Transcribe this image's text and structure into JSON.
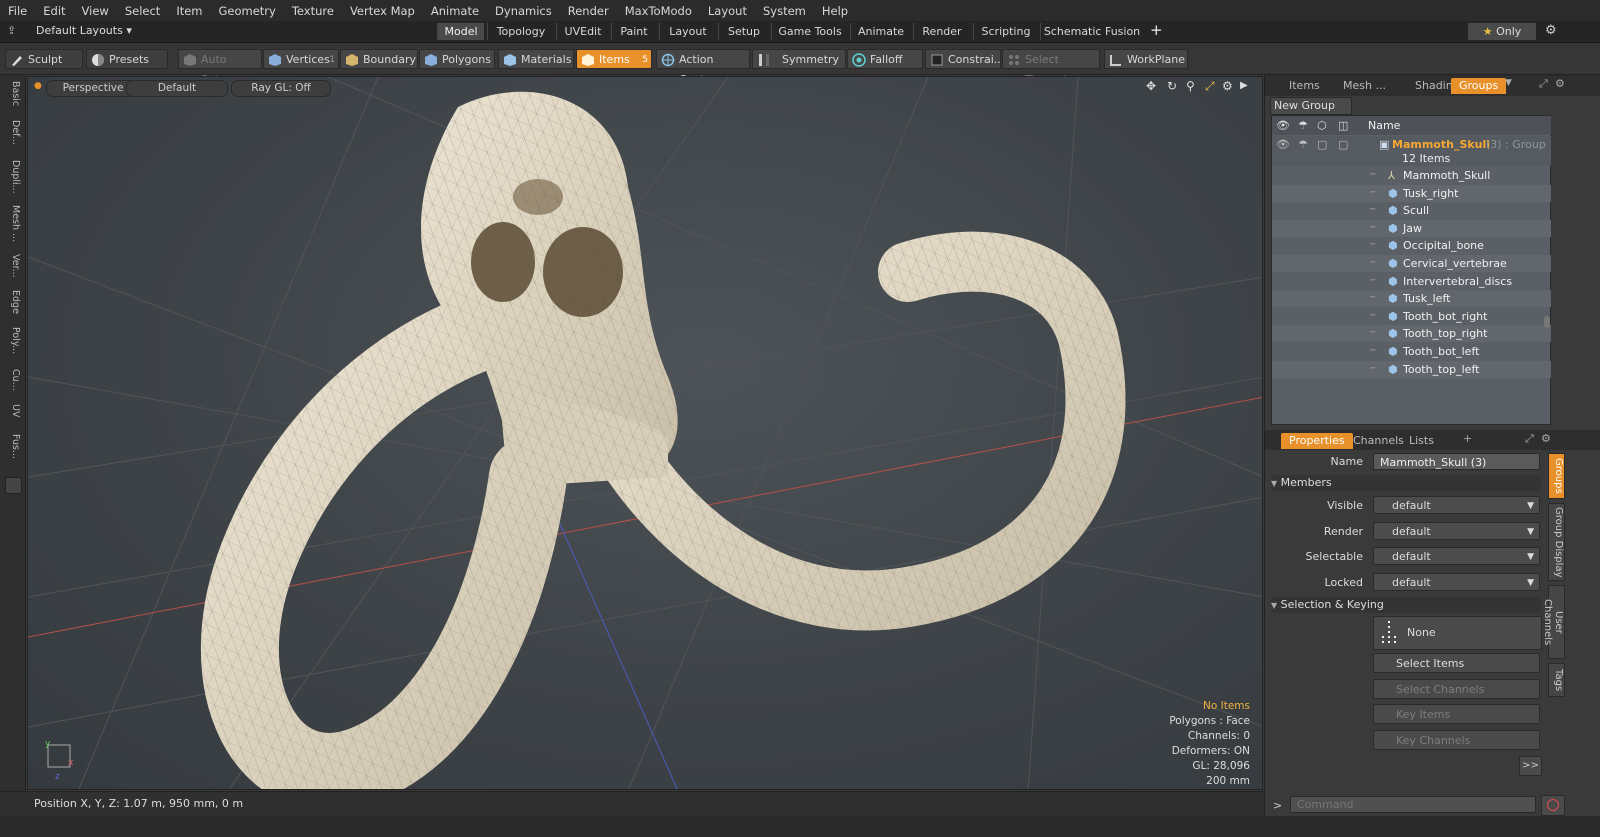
{
  "menu": [
    "File",
    "Edit",
    "View",
    "Select",
    "Item",
    "Geometry",
    "Texture",
    "Vertex Map",
    "Animate",
    "Dynamics",
    "Render",
    "MaxToModo",
    "Layout",
    "System",
    "Help"
  ],
  "layout_selector": "Default Layouts",
  "layout_tabs": [
    "Model",
    "Topology",
    "UVEdit",
    "Paint",
    "Layout",
    "Setup",
    "Game Tools",
    "Animate",
    "Render",
    "Scripting",
    "Schematic Fusion"
  ],
  "layout_only": "Only",
  "toolbar": {
    "sculpt": "Sculpt",
    "presets": "Presets",
    "auto_select": "Auto Select",
    "vertices": "Vertices",
    "vertices_count": "1",
    "boundary": "Boundary",
    "polygons": "Polygons",
    "materials": "Materials",
    "items": "Items",
    "items_count": "5",
    "action_center": "Action Center",
    "symmetry": "Symmetry",
    "falloff": "Falloff",
    "constraints": "Constrai...",
    "select_through": "Select Through",
    "workplane": "WorkPlane"
  },
  "left_tabs": [
    "Basic",
    "Def...",
    "Dupli...",
    "Mesh ...",
    "Ver...",
    "Edge",
    "Poly...",
    "Cu...",
    "UV",
    "Fus..."
  ],
  "viewport": {
    "perspective": "Perspective",
    "shading": "Default",
    "raygl": "Ray GL: Off",
    "info_items": "No Items",
    "info_polygons": "Polygons : Face",
    "info_channels": "Channels: 0",
    "info_deformers": "Deformers: ON",
    "info_gl": "GL: 28,096",
    "info_scale": "200 mm"
  },
  "status": {
    "position": "Position X, Y, Z:  1.07 m, 950 mm, 0 m"
  },
  "panel_tabs": [
    "Items",
    "Mesh ...",
    "Shading",
    "Groups"
  ],
  "new_group": "New Group",
  "tree": {
    "name_header": "Name",
    "group_name": "Mammoth_Skull",
    "group_suffix": "(3) : Group",
    "group_count": "12 Items",
    "items": [
      "Mammoth_Skull",
      "Tusk_right",
      "Scull",
      "Jaw",
      "Occipital_bone",
      "Cervical_vertebrae",
      "Intervertebral_discs",
      "Tusk_left",
      "Tooth_bot_right",
      "Tooth_top_right",
      "Tooth_bot_left",
      "Tooth_top_left"
    ]
  },
  "props_tabs": [
    "Properties",
    "Channels",
    "Lists"
  ],
  "props": {
    "name_label": "Name",
    "name_value": "Mammoth_Skull (3)",
    "members": "Members",
    "visible_label": "Visible",
    "render_label": "Render",
    "selectable_label": "Selectable",
    "locked_label": "Locked",
    "default_value": "default",
    "sel_keying": "Selection & Keying",
    "none": "None",
    "select_items": "Select Items",
    "select_channels": "Select Channels",
    "key_items": "Key Items",
    "key_channels": "Key Channels",
    "more": ">>"
  },
  "side_tabs": [
    "Groups",
    "Group Display",
    "User Channels",
    "Tags"
  ],
  "command_placeholder": "Command",
  "colors": {
    "accent": "#e8902a",
    "tree_bg": "#5b6066",
    "viewport": "#42474b",
    "bone": "#e2d9c6"
  }
}
